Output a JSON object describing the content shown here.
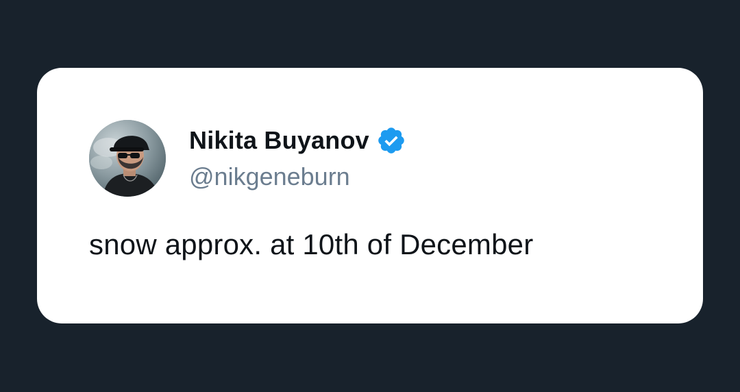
{
  "tweet": {
    "author": {
      "name": "Nikita Buyanov",
      "handle": "@nikgeneburn",
      "verified": true,
      "avatar_icon": "user-avatar-photo"
    },
    "text": "snow approx. at 10th of December"
  },
  "colors": {
    "background": "#18222c",
    "card": "#ffffff",
    "name": "#0f1419",
    "handle": "#6b7d8f",
    "verified_badge": "#1d9bf0"
  }
}
